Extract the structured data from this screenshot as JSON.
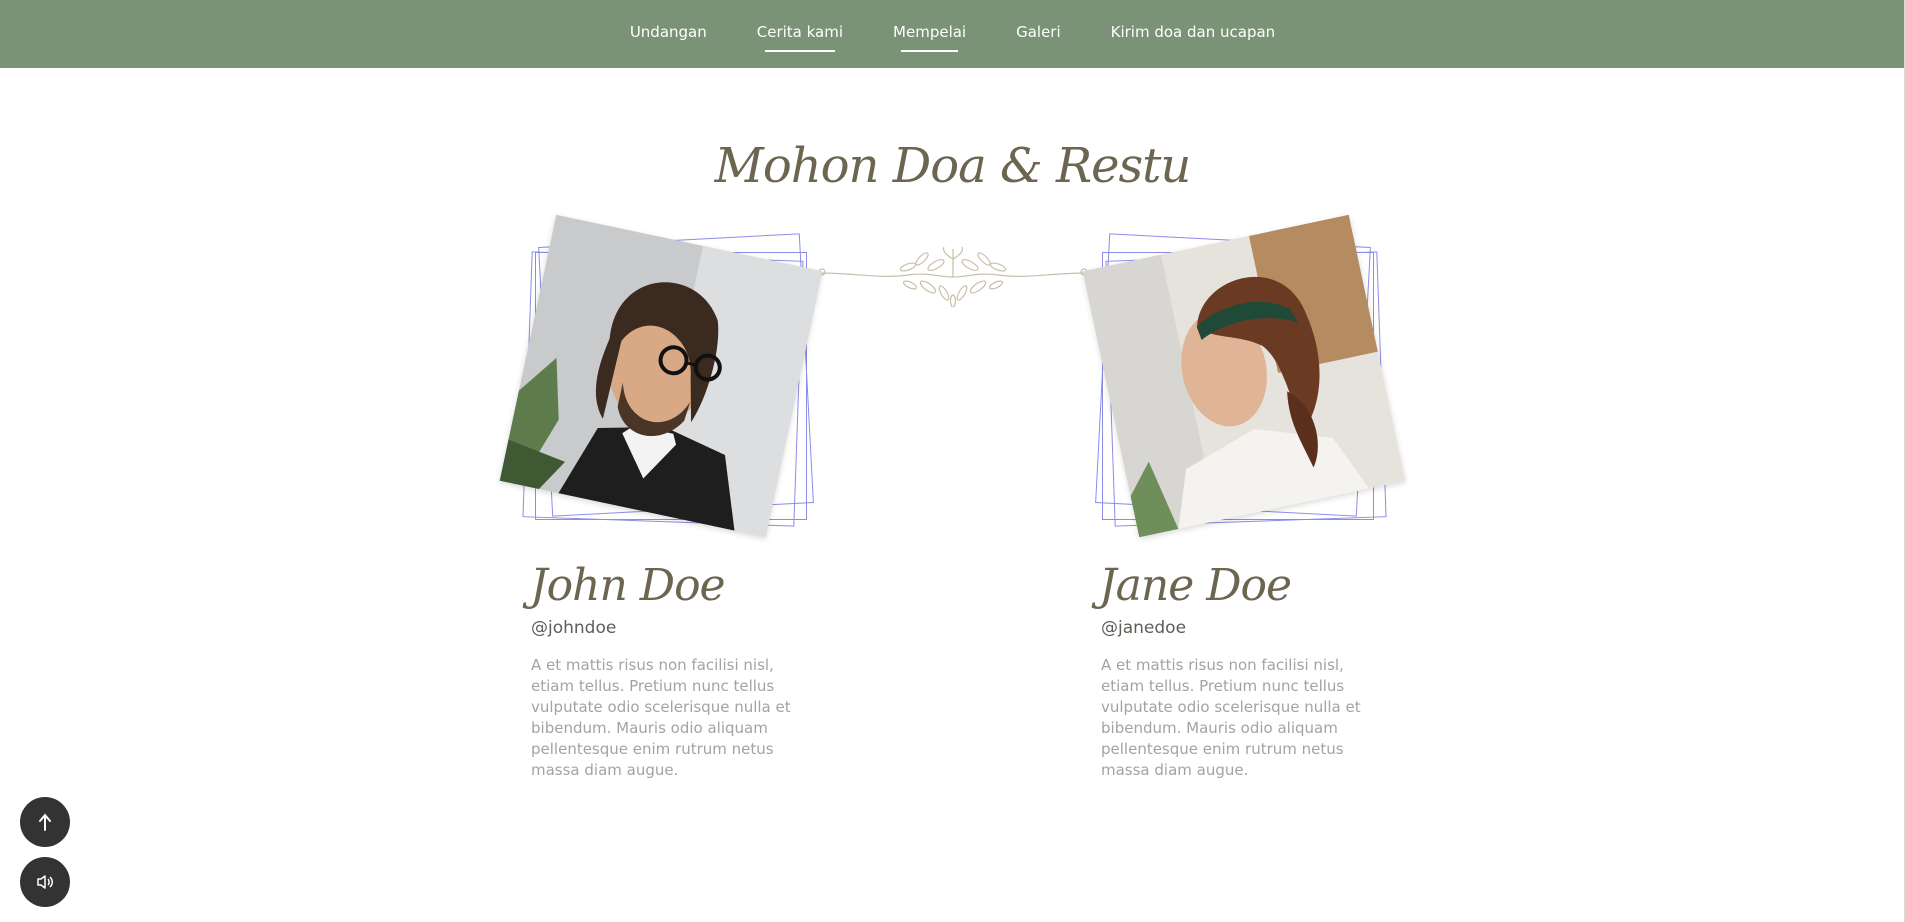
{
  "nav": {
    "items": [
      {
        "label": "Undangan"
      },
      {
        "label": "Cerita kami"
      },
      {
        "label": "Mempelai"
      },
      {
        "label": "Galeri"
      },
      {
        "label": "Kirim doa dan ucapan"
      }
    ]
  },
  "section": {
    "title": "Mohon Doa & Restu"
  },
  "groom": {
    "name": "John Doe",
    "handle": "@johndoe",
    "bio": "A et mattis risus non facilisi nisl, etiam tellus. Pretium nunc tellus vulputate odio scelerisque nulla et bibendum. Mauris odio aliquam pellentesque enim rutrum netus massa diam augue."
  },
  "bride": {
    "name": "Jane Doe",
    "handle": "@janedoe",
    "bio": "A et mattis risus non facilisi nisl, etiam tellus. Pretium nunc tellus vulputate odio scelerisque nulla et bibendum. Mauris odio aliquam pellentesque enim rutrum netus massa diam augue."
  },
  "buttons": {
    "scroll_top_icon": "arrow-up-icon",
    "audio_icon": "speaker-icon"
  },
  "colors": {
    "nav_bg": "#7a9275",
    "title": "#6c6550",
    "frame": "#8c8ce6",
    "fab": "#333333"
  }
}
